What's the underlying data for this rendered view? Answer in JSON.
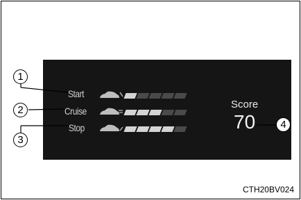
{
  "display": {
    "rows": [
      {
        "label": "Start",
        "level": 1,
        "segments": 5,
        "icon": "car-start-icon"
      },
      {
        "label": "Cruise",
        "level": 3,
        "segments": 5,
        "icon": "car-cruise-icon"
      },
      {
        "label": "Stop",
        "level": 4,
        "segments": 5,
        "icon": "car-stop-icon"
      }
    ],
    "score_label": "Score",
    "score_value": "70"
  },
  "callouts": [
    "1",
    "2",
    "3",
    "4"
  ],
  "caption": "CTH20BV024"
}
